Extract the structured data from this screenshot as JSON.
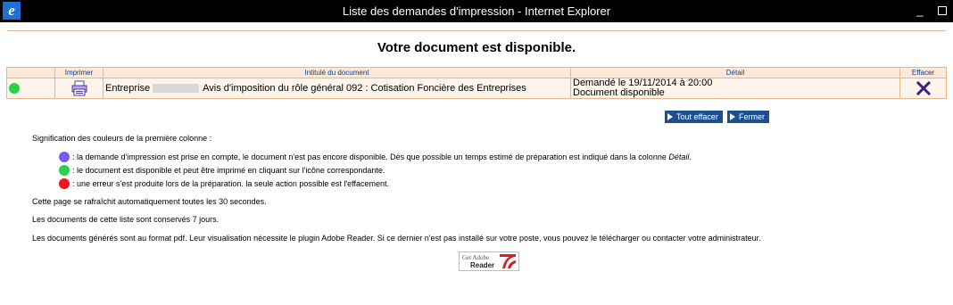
{
  "window": {
    "title": "Liste des demandes d'impression - Internet Explorer",
    "minimize": "_"
  },
  "page": {
    "title": "Votre document est disponible."
  },
  "table": {
    "headers": {
      "status": "",
      "print": "Imprimer",
      "doc": "Intitulé du document",
      "detail": "Détail",
      "delete": "Effacer"
    },
    "rows": [
      {
        "status_color": "#2bd14a",
        "doc_prefix": "Entreprise",
        "doc_title": "Avis d'imposition du rôle général 092 : Cotisation Foncière des Entreprises",
        "detail_line1": "Demandé le 19/11/2014 à 20:00",
        "detail_line2": "Document disponible"
      }
    ]
  },
  "buttons": {
    "clear_all": "Tout effacer",
    "close": "Fermer"
  },
  "legend": {
    "intro": "Signification des couleurs de la première colonne :",
    "purple_a": ": la demande d'impression est prise en compte, le document n'est pas encore disponible. Dès que possible un temps estimé de préparation est indiqué dans la colonne ",
    "purple_b": "Détail",
    "purple_c": ".",
    "green": ": le document est disponible et peut être imprimé en cliquant sur l'icône correspondante.",
    "red": ": une erreur s'est produite lors de la préparation. la seule action possible est l'effacement."
  },
  "info": {
    "refresh": "Cette page se rafraîchit automatiquement toutes les 30 secondes.",
    "retention": "Les documents de cette liste sont conservés 7 jours.",
    "pdf": "Les documents générés sont au format pdf. Leur visualisation nécessite le plugin Adobe Reader. Si ce dernier n'est pas installé sur votre poste, vous pouvez le télécharger ou contacter votre administrateur."
  },
  "adobe": {
    "get": "Get Adobe",
    "reader": "Reader"
  },
  "colors": {
    "green": "#2bd14a",
    "purple": "#7a5af0",
    "red": "#f0161d",
    "button": "#1d4f93",
    "header_text": "#0b3e91"
  }
}
